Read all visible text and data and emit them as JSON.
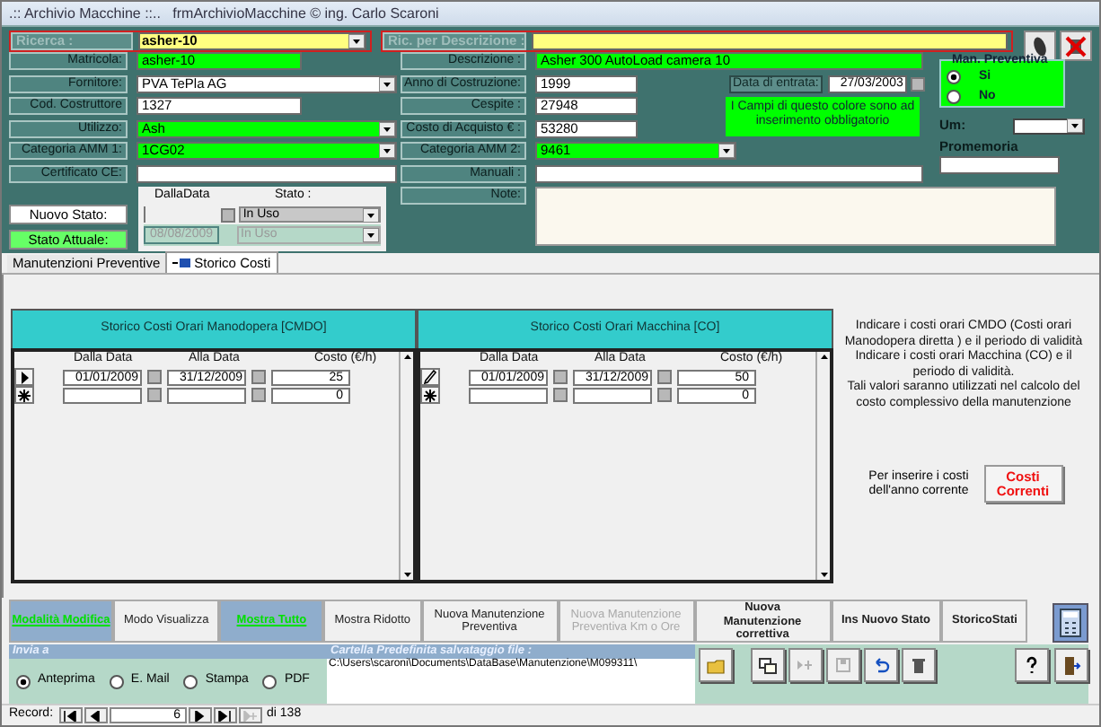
{
  "window": {
    "title": ".:: Archivio Macchine ::..   frmArchivioMacchine © ing. Carlo Scaroni"
  },
  "search": {
    "label": "Ricerca :",
    "value": "asher-10",
    "desc_label": "Ric. per Descrizione :"
  },
  "left_fields": [
    {
      "label": "Matricola:",
      "value": "asher-10",
      "kind": "text",
      "required": true
    },
    {
      "label": "Fornitore:",
      "value": "PVA TePla AG",
      "kind": "combo",
      "required": false
    },
    {
      "label": "Cod. Costruttore",
      "value": "1327",
      "kind": "text",
      "required": false
    },
    {
      "label": "Utilizzo:",
      "value": "Ash",
      "kind": "combo",
      "required": true
    },
    {
      "label": "Categoria AMM 1:",
      "value": "1CG02",
      "kind": "combo",
      "required": true
    },
    {
      "label": "Certificato CE:",
      "kind": "line",
      "required": false
    }
  ],
  "mid_fields": [
    {
      "label": "Descrizione :",
      "value": "Asher 300 AutoLoad camera 10",
      "kind": "line",
      "required": true
    },
    {
      "label": "Anno di Costruzione:",
      "value": "1999",
      "kind": "text",
      "required": false
    },
    {
      "label": "Cespite :",
      "value": "27948",
      "kind": "text",
      "required": false
    },
    {
      "label": "Costo di Acquisto € :",
      "value": "53280",
      "kind": "text",
      "required": false
    },
    {
      "label": "Categoria AMM 2:",
      "value": "9461",
      "kind": "combo",
      "required": true
    },
    {
      "label": "Manuali :",
      "kind": "line",
      "required": false
    }
  ],
  "entry_date": {
    "label": "Data di entrata:",
    "value": "27/03/2003"
  },
  "notice": "I Campi di questo colore sono ad inserimento obbligatorio",
  "man_preventiva": {
    "title": "Man. Preventiva",
    "options": [
      {
        "label": "Si",
        "selected": true
      },
      {
        "label": "No",
        "selected": false
      }
    ]
  },
  "um_label": "Um:",
  "promemoria_label": "Promemoria",
  "note_label": "Note:",
  "stato": {
    "col_from": "DallaData",
    "col_state": "Stato :",
    "nuovo_label": "Nuovo Stato:",
    "attuale_label": "Stato Attuale:",
    "nuovo_state": "In Uso",
    "attuale_date": "08/08/2009",
    "attuale_state": "In Uso"
  },
  "tabs": [
    {
      "label": "Manutenzioni Preventive",
      "selected": false
    },
    {
      "label": "Storico Costi",
      "selected": true
    }
  ],
  "cost_tables": [
    {
      "title": "Storico Costi Orari Manodopera [CMDO]",
      "columns": [
        "Dalla Data",
        "Alla Data",
        "Costo (€/h)"
      ],
      "rows": [
        {
          "kind": "current",
          "from": "01/01/2009",
          "to": "31/12/2009",
          "cost": "25"
        },
        {
          "kind": "new",
          "cost": "0"
        }
      ]
    },
    {
      "title": "Storico Costi Orari Macchina [CO]",
      "columns": [
        "Dalla Data",
        "Alla Data",
        "Costo (€/h)"
      ],
      "rows": [
        {
          "kind": "editing",
          "from": "01/01/2009",
          "to": "31/12/2009",
          "cost": "50"
        },
        {
          "kind": "new",
          "cost": "0"
        }
      ]
    }
  ],
  "info": [
    "Indicare i costi orari CMDO (Costi orari Manodopera diretta ) e il periodo di validità",
    "Indicare i costi orari Macchina (CO) e il periodo di validità.",
    "Tali  valori saranno utilizzati nel calcolo del costo complessivo della manutenzione"
  ],
  "current_costs": {
    "hint": "Per inserire i costi dell'anno corrente",
    "button": "Costi Correnti"
  },
  "buttons": [
    {
      "label": "Modalità Modifica",
      "kind": "highlight",
      "disabled": false
    },
    {
      "label": "Modo Visualizza",
      "kind": "plain",
      "disabled": false
    },
    {
      "label": "Mostra Tutto",
      "kind": "highlight",
      "disabled": false
    },
    {
      "label": "Mostra Ridotto",
      "kind": "plain",
      "disabled": false
    },
    {
      "label": "Nuova Manutenzione Preventiva",
      "kind": "plain",
      "disabled": false
    },
    {
      "label": "Nuova Manutenzione Preventiva Km o Ore",
      "kind": "plain",
      "disabled": true
    },
    {
      "label": "Nuova Manutenzione correttiva",
      "kind": "bold",
      "disabled": false
    },
    {
      "label": "Ins Nuovo Stato",
      "kind": "bold",
      "disabled": false
    },
    {
      "label": "StoricoStati",
      "kind": "bold",
      "disabled": false
    }
  ],
  "send": {
    "label": "Invia a",
    "options": [
      {
        "label": "Anteprima",
        "selected": true
      },
      {
        "label": "E. Mail",
        "selected": false
      },
      {
        "label": "Stampa",
        "selected": false
      },
      {
        "label": "PDF",
        "selected": false
      }
    ]
  },
  "folder": {
    "label": "Cartella Predefinita salvataggio file :",
    "path": "C:\\Users\\scaroni\\Documents\\DataBase\\Manutenzione\\M099311\\"
  },
  "toolbar": [
    {
      "kind": "new",
      "disabled": false
    },
    {
      "kind": "goto-new",
      "disabled": true
    },
    {
      "kind": "save",
      "disabled": true
    },
    {
      "kind": "undo",
      "disabled": false
    },
    {
      "kind": "delete",
      "disabled": false
    }
  ],
  "record": {
    "label": "Record:",
    "current": "6",
    "total": "di 138",
    "new_disabled": true
  }
}
